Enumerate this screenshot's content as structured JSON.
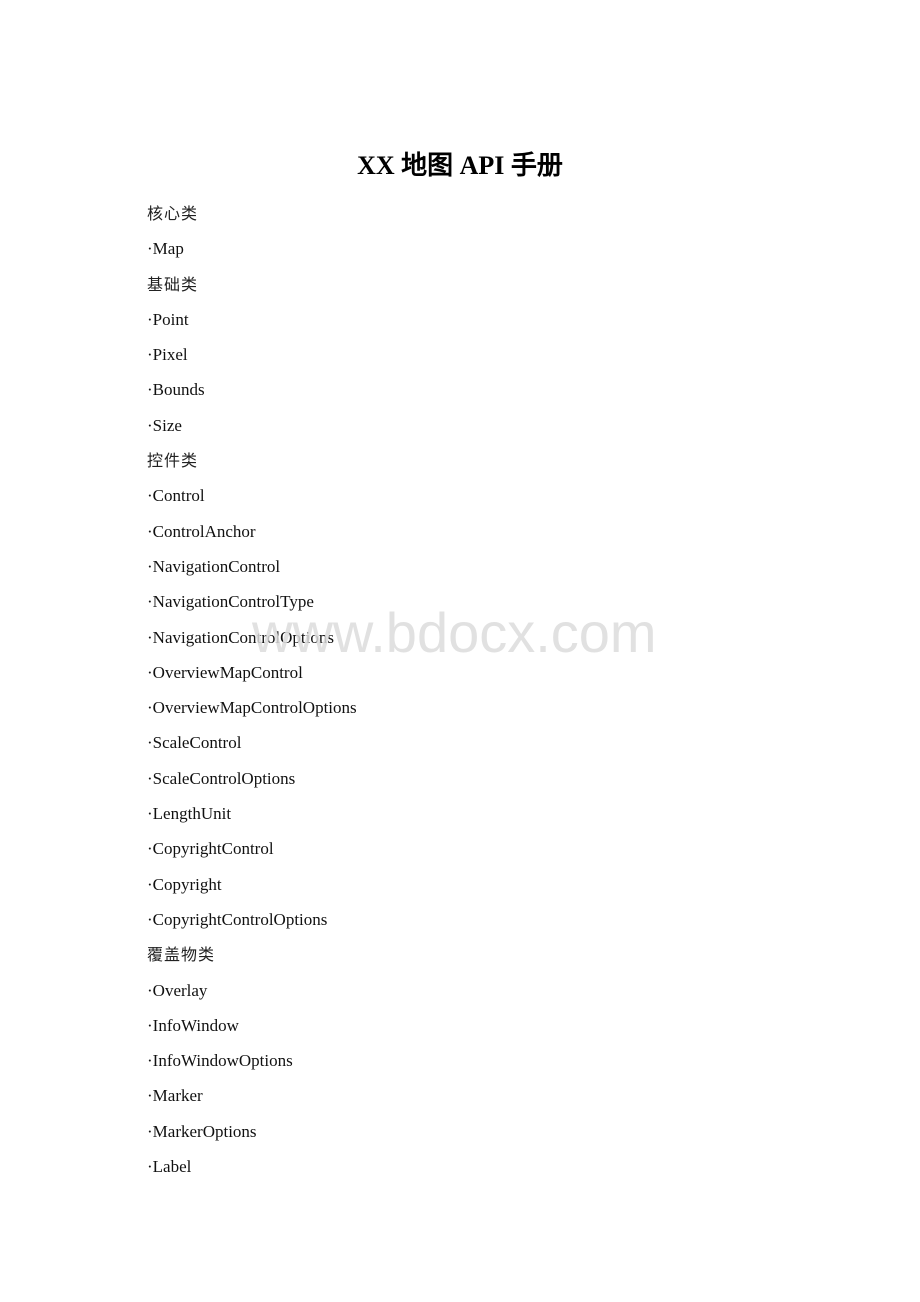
{
  "document": {
    "title": "XX 地图 API 手册",
    "watermark": "www.bdocx.com",
    "entries": [
      {
        "type": "heading",
        "text": "核心类"
      },
      {
        "type": "item",
        "text": "·Map"
      },
      {
        "type": "heading",
        "text": "基础类"
      },
      {
        "type": "item",
        "text": "·Point"
      },
      {
        "type": "item",
        "text": "·Pixel"
      },
      {
        "type": "item",
        "text": "·Bounds"
      },
      {
        "type": "item",
        "text": "·Size"
      },
      {
        "type": "heading",
        "text": "控件类"
      },
      {
        "type": "item",
        "text": "·Control"
      },
      {
        "type": "item",
        "text": "·ControlAnchor"
      },
      {
        "type": "item",
        "text": "·NavigationControl"
      },
      {
        "type": "item",
        "text": "·NavigationControlType"
      },
      {
        "type": "item",
        "text": "·NavigationControlOptions"
      },
      {
        "type": "item",
        "text": "·OverviewMapControl"
      },
      {
        "type": "item",
        "text": "·OverviewMapControlOptions"
      },
      {
        "type": "item",
        "text": "·ScaleControl"
      },
      {
        "type": "item",
        "text": "·ScaleControlOptions"
      },
      {
        "type": "item",
        "text": "·LengthUnit"
      },
      {
        "type": "item",
        "text": "·CopyrightControl"
      },
      {
        "type": "item",
        "text": "·Copyright"
      },
      {
        "type": "item",
        "text": "·CopyrightControlOptions"
      },
      {
        "type": "heading",
        "text": "覆盖物类"
      },
      {
        "type": "item",
        "text": "·Overlay"
      },
      {
        "type": "item",
        "text": "·InfoWindow"
      },
      {
        "type": "item",
        "text": "·InfoWindowOptions"
      },
      {
        "type": "item",
        "text": "·Marker"
      },
      {
        "type": "item",
        "text": "·MarkerOptions"
      },
      {
        "type": "item",
        "text": "·Label"
      }
    ]
  }
}
